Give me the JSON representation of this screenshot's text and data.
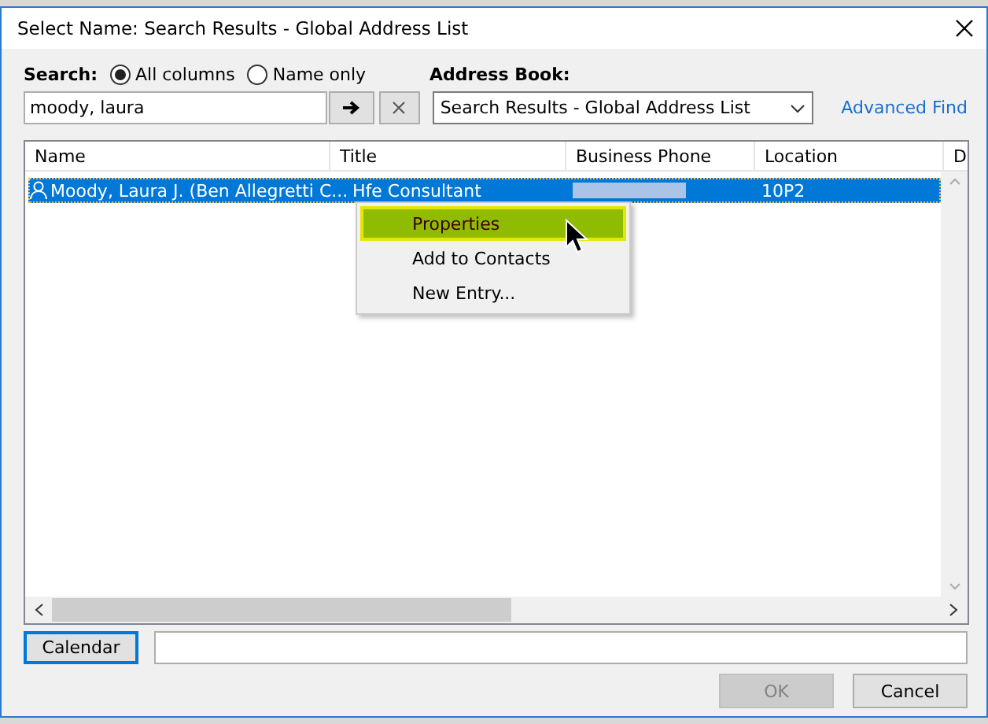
{
  "window": {
    "title": "Select Name: Search Results - Global Address List"
  },
  "search": {
    "label": "Search:",
    "value": "moody, laura",
    "options": [
      {
        "label": "All columns",
        "selected": true
      },
      {
        "label": "Name only",
        "selected": false
      }
    ]
  },
  "address_book": {
    "label": "Address Book:",
    "value": "Search Results - Global Address List"
  },
  "advanced_find": "Advanced Find",
  "table": {
    "columns": [
      "Name",
      "Title",
      "Business Phone",
      "Location",
      "D"
    ],
    "rows": [
      {
        "name": "Moody, Laura J. (Ben Allegretti C...",
        "title": "Hfe Consultant",
        "location": "10P2",
        "selected": true
      }
    ]
  },
  "context_menu": [
    {
      "label": "Properties",
      "selected": true
    },
    {
      "label": "Add to Contacts",
      "selected": false
    },
    {
      "label": "New Entry...",
      "selected": false
    }
  ],
  "calendar_button": "Calendar",
  "buttons": [
    {
      "label": "OK",
      "disabled": true
    },
    {
      "label": "Cancel",
      "disabled": false
    }
  ]
}
